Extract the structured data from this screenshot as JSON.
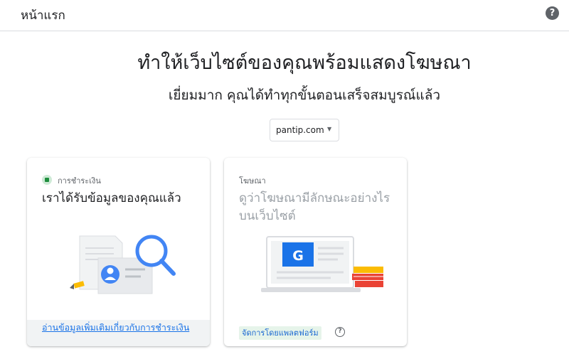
{
  "header": {
    "title": "หน้าแรก",
    "help_icon": "help-circle-icon"
  },
  "main": {
    "headline": "ทำให้เว็บไซต์ของคุณพร้อมแสดงโฆษณา",
    "subline": "เยี่ยมมาก คุณได้ทำทุกขั้นตอนเสร็จสมบูรณ์แล้ว",
    "site_select": {
      "value": "pantip.com"
    }
  },
  "cards": {
    "payment": {
      "status_label": "การชำระเงิน",
      "status_color": "#1e8e3e",
      "heading": "เราได้รับข้อมูลของคุณแล้ว",
      "link": "อ่านข้อมูลเพิ่มเติมเกี่ยวกับการชำระเงิน"
    },
    "ads": {
      "label": "โฆษณา",
      "heading": "ดูว่าโฆษณามีลักษณะอย่างไรบนเว็บไซต์",
      "badge": "จัดการโดยแพลตฟอร์ม"
    }
  },
  "colors": {
    "accent": "#1a73e8",
    "google_blue": "#1a73e8",
    "muted_text": "#9aa0a6"
  }
}
